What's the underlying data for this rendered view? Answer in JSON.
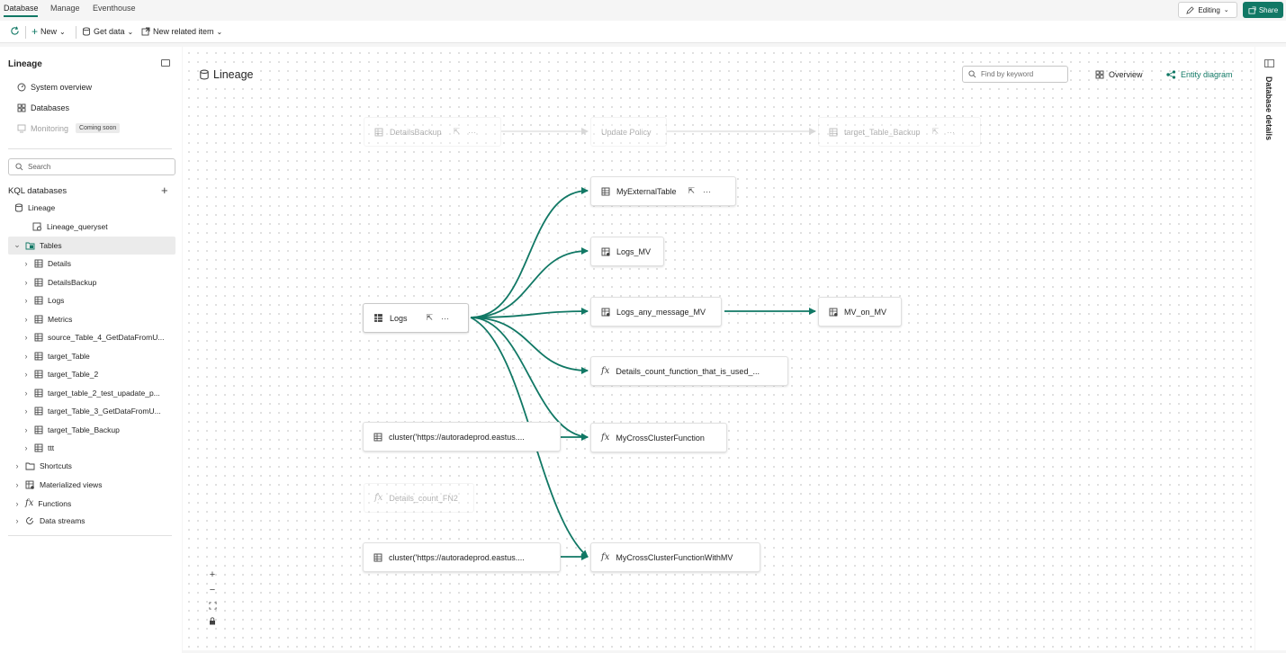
{
  "tabs": [
    "Database",
    "Manage",
    "Eventhouse"
  ],
  "top_buttons": {
    "editing": "Editing",
    "share": "Share"
  },
  "toolbar": {
    "new": "New",
    "get_data": "Get data",
    "new_related_item": "New related item"
  },
  "sidebar": {
    "title": "Lineage",
    "nav": [
      {
        "label": "System overview",
        "icon": "gauge-icon"
      },
      {
        "label": "Databases",
        "icon": "grid-icon"
      },
      {
        "label": "Monitoring",
        "icon": "monitoring-icon",
        "badge": "Coming soon",
        "disabled": true
      }
    ],
    "search_placeholder": "Search",
    "kql_title": "KQL databases",
    "tree": {
      "database": "Lineage",
      "queryset": "Lineage_queryset",
      "tables_label": "Tables",
      "tables": [
        "Details",
        "DetailsBackup",
        "Logs",
        "Metrics",
        "source_Table_4_GetDataFromU...",
        "target_Table",
        "target_Table_2",
        "target_table_2_test_upadate_p...",
        "target_Table_3_GetDataFromU...",
        "target_Table_Backup",
        "ttt"
      ],
      "folders": [
        "Shortcuts",
        "Materialized views",
        "Functions",
        "Data streams"
      ]
    }
  },
  "main": {
    "title": "Lineage",
    "find_placeholder": "Find by keyword",
    "overview": "Overview",
    "entity_diagram": "Entity diagram",
    "nodes": {
      "details_backup": "DetailsBackup",
      "update_policy": "Update Policy",
      "target_table_backup": "target_Table_Backup",
      "my_external_table": "MyExternalTable",
      "logs_mv": "Logs_MV",
      "logs": "Logs",
      "logs_any_message_mv": "Logs_any_message_MV",
      "mv_on_mv": "MV_on_MV",
      "details_count_function": "Details_count_function_that_is_used_...",
      "cluster_1": "cluster('https://autoradeprod.eastus....",
      "my_cross_cluster_function": "MyCrossClusterFunction",
      "details_count_fn2": "Details_count_FN2",
      "cluster_2": "cluster('https://autoradeprod.eastus....",
      "my_cross_cluster_function_with_mv": "MyCrossClusterFunctionWithMV"
    }
  },
  "right_rail": {
    "label": "Database details"
  },
  "colors": {
    "accent": "#117865",
    "edge": "#117865",
    "faded_edge": "#d0d0d0"
  }
}
